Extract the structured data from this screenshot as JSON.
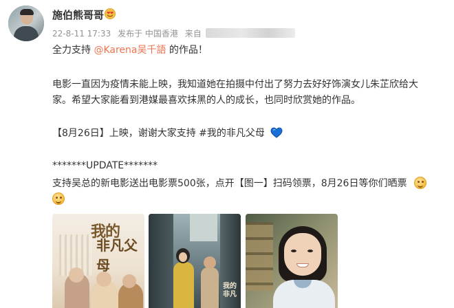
{
  "post": {
    "user_name": "施伯熊哥哥",
    "meta": {
      "timestamp": "22-8-11 17:33",
      "published_in": "发布于 中国香港",
      "source_prefix": "来自"
    },
    "lines": {
      "line1_prefix": "全力支持 ",
      "mention": "@Karena吴千語",
      "line1_suffix": " 的作品！",
      "line2": "电影一直因为疫情未能上映，我知道她在拍摄中付出了努力去好好饰演女儿朱芷欣给大",
      "line3": "家。希望大家能看到港媒最喜欢抹黑的人的成长，也同时欣赏她的作品。",
      "line4": "【8月26日】上映，谢谢大家支持 #我的非凡父母",
      "line5": "*******UPDATE*******",
      "line6": "支持吴总的新电影送出电影票500张，点开【图一】扫码领票，8月26日等你们晒票"
    },
    "images": {
      "poster_title_1": "我的",
      "poster_title_2": "非凡父母",
      "still_logo": "我的非凡"
    },
    "icons": {
      "badge": "heart-eyes-emoji-icon",
      "heart": "blue-heart-icon",
      "smile": "smile-emoji-icon"
    },
    "colors": {
      "mention": "#eb7350",
      "text": "#333333",
      "meta": "#939393",
      "heart": "#1a6fd6"
    }
  }
}
